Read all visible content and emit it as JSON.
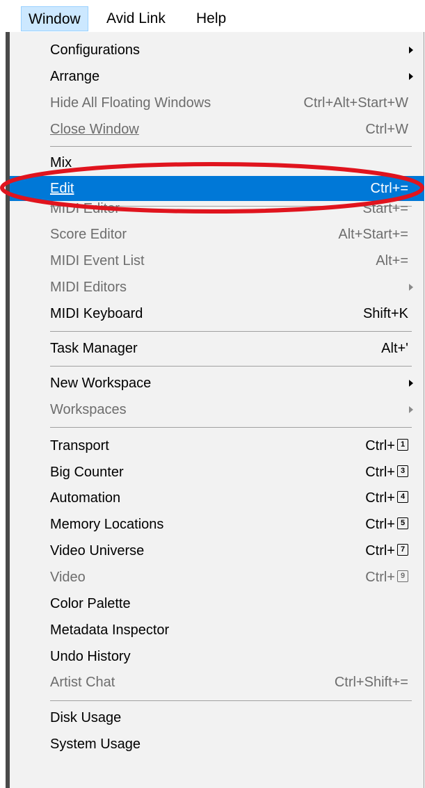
{
  "menubar": {
    "items": [
      {
        "label": "Window"
      },
      {
        "label": "Avid Link"
      },
      {
        "label": "Help"
      }
    ]
  },
  "menu": {
    "configurations": {
      "label": "Configurations"
    },
    "arrange": {
      "label": "Arrange"
    },
    "hide_floating": {
      "label": "Hide All Floating Windows",
      "shortcut": "Ctrl+Alt+Start+W"
    },
    "close_window": {
      "label": "Close Window",
      "shortcut": "Ctrl+W"
    },
    "mix": {
      "label": "Mix"
    },
    "edit": {
      "label": "Edit",
      "shortcut": "Ctrl+="
    },
    "midi_editor": {
      "label": "MIDI Editor",
      "shortcut": "Start+="
    },
    "score_editor": {
      "label": "Score Editor",
      "shortcut": "Alt+Start+="
    },
    "midi_event_list": {
      "label": "MIDI Event List",
      "shortcut": "Alt+="
    },
    "midi_editors": {
      "label": "MIDI Editors"
    },
    "midi_keyboard": {
      "label": "MIDI Keyboard",
      "shortcut": "Shift+K"
    },
    "task_manager": {
      "label": "Task Manager",
      "shortcut": "Alt+'"
    },
    "new_workspace": {
      "label": "New Workspace"
    },
    "workspaces": {
      "label": "Workspaces"
    },
    "transport": {
      "label": "Transport",
      "shortcut_prefix": "Ctrl+",
      "key": "1"
    },
    "big_counter": {
      "label": "Big Counter",
      "shortcut_prefix": "Ctrl+",
      "key": "3"
    },
    "automation": {
      "label": "Automation",
      "shortcut_prefix": "Ctrl+",
      "key": "4"
    },
    "memory_locations": {
      "label": "Memory Locations",
      "shortcut_prefix": "Ctrl+",
      "key": "5"
    },
    "video_universe": {
      "label": "Video Universe",
      "shortcut_prefix": "Ctrl+",
      "key": "7"
    },
    "video": {
      "label": "Video",
      "shortcut_prefix": "Ctrl+",
      "key": "9"
    },
    "color_palette": {
      "label": "Color Palette"
    },
    "metadata_inspector": {
      "label": "Metadata Inspector"
    },
    "undo_history": {
      "label": "Undo History"
    },
    "artist_chat": {
      "label": "Artist Chat",
      "shortcut": "Ctrl+Shift+="
    },
    "disk_usage": {
      "label": "Disk Usage"
    },
    "system_usage": {
      "label": "System Usage"
    }
  },
  "colors": {
    "highlight": "#0078d7",
    "annotation": "#e0141e",
    "disabled_text": "#6d6d6d",
    "menu_background": "#f2f2f2"
  }
}
